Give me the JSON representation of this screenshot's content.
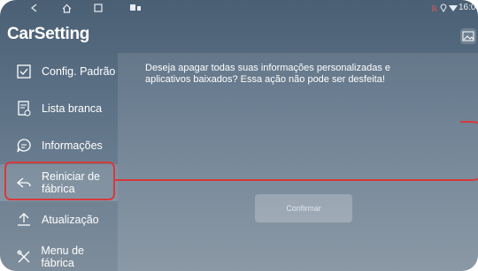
{
  "app": {
    "title": "CarSetting"
  },
  "statusbar": {
    "time": "16:0"
  },
  "sidebar": {
    "items": [
      {
        "label": "Config. Padrão"
      },
      {
        "label": "Lista branca"
      },
      {
        "label": "Informações"
      },
      {
        "label_line1": "Reiniciar de",
        "label_line2": "fábrica"
      },
      {
        "label": "Atualização"
      },
      {
        "label": "Menu de fábrica"
      }
    ]
  },
  "main": {
    "message_line1": "Deseja apagar todas suas informações personalizadas e",
    "message_line2": "aplicativos baixados? Essa ação não pode ser desfeita!",
    "confirm_label": "Confirmar"
  },
  "colors": {
    "highlight": "#d63a3a",
    "background": "#5b7085"
  }
}
